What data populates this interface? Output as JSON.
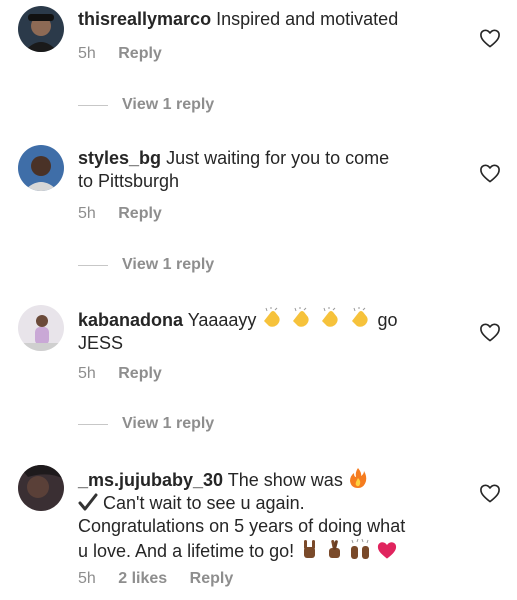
{
  "comments": [
    {
      "username": "thisreallymarco",
      "text": "Inspired and motivated",
      "time": "5h",
      "reply_label": "Reply",
      "view_replies": "View 1 reply",
      "avatar_color": "#2b3a4a"
    },
    {
      "username": "styles_bg",
      "text_line1": "Just waiting for you to come",
      "text_line2": "to Pittsburgh",
      "time": "5h",
      "reply_label": "Reply",
      "view_replies": "View 1 reply",
      "avatar_color": "#3f6ea8"
    },
    {
      "username": "kabanadona",
      "text_before": "Yaaaayy",
      "text_after": "go",
      "text_line2": "JESS",
      "emojis": [
        "clapping-hands",
        "clapping-hands",
        "clapping-hands",
        "clapping-hands"
      ],
      "time": "5h",
      "reply_label": "Reply",
      "view_replies": "View 1 reply",
      "avatar_color": "#c9b7c9"
    },
    {
      "username": "_ms.jujubaby_30",
      "text_line1": "The show was",
      "text_line2": "Can't wait to see u again.",
      "text_line3": "Congratulations on 5 years of doing what",
      "text_line4": "u love. And a lifetime to go!",
      "emojis": [
        "fire",
        "check-mark",
        "sign-of-horns",
        "crossed-fingers",
        "raising-hands",
        "red-heart"
      ],
      "time": "5h",
      "likes": "2 likes",
      "reply_label": "Reply",
      "avatar_color": "#3a2f33"
    }
  ],
  "colors": {
    "text": "#262626",
    "meta": "#8e8e8e",
    "heart_outline": "#262626",
    "heart_fill": "#e0245e"
  }
}
